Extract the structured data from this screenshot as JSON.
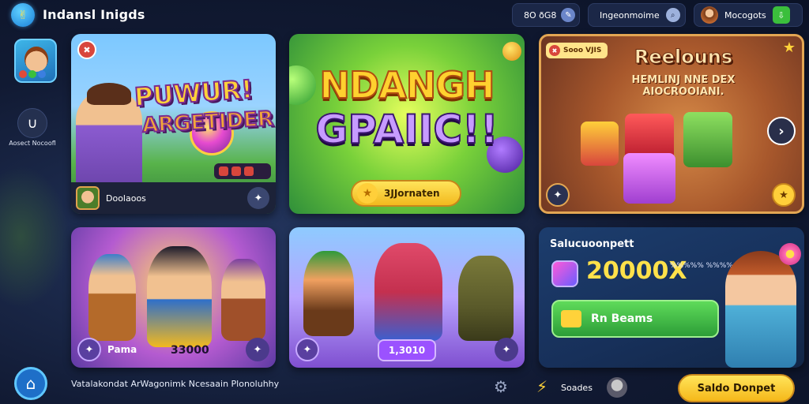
{
  "app": {
    "title": "Indansl Inigds",
    "logo_icon": "✌"
  },
  "topbar": {
    "coins_text": "8O ðG8",
    "coins_icon": "✎",
    "search_text": "Ingeonmoime",
    "search_icon": "⌕",
    "profile_name": "Mocogots",
    "profile_icon": "⇩"
  },
  "rail": {
    "item_icon": "∪",
    "item_label": "Aosect Nocoofl"
  },
  "cards": {
    "a": {
      "title_line1": "PUWUR!",
      "title_line2": "ARGETIDER",
      "close_icon": "✖",
      "footer_label": "Doolaoos",
      "footer_icon": "✦"
    },
    "b": {
      "title_line1": "NDANGH",
      "title_line2": "GPAIIC!!",
      "cta_label": "3JJornaten",
      "cta_icon": "★"
    },
    "c": {
      "tag_text": "Sooo VJIS",
      "tag_icon": "✖",
      "title": "Reelouns",
      "subtitle": "HEMLINJ NNE DEX AIOCROOIANI.",
      "next_icon": "›",
      "left_icon": "✦",
      "right_icon": "★",
      "top_star_icon": "★"
    },
    "d": {
      "label": "Pama",
      "value": "33000",
      "left_icon": "✦",
      "right_icon": "✦"
    },
    "e": {
      "value": "1,3010",
      "left_icon": "✦",
      "right_icon": "✦"
    },
    "f": {
      "title": "Salucuoonpett",
      "value": "20000X",
      "tag": "%%%%% %%%%",
      "button_label": "Rn Beams"
    }
  },
  "bottom": {
    "home_icon": "⌂",
    "text": "Vatalakondat ArWagonimk Ncesaain Plonoluhhy",
    "gear_icon": "⚙",
    "bolt_icon": "⚡",
    "label": "Soades",
    "cta_label": "Saldo Donpet"
  }
}
